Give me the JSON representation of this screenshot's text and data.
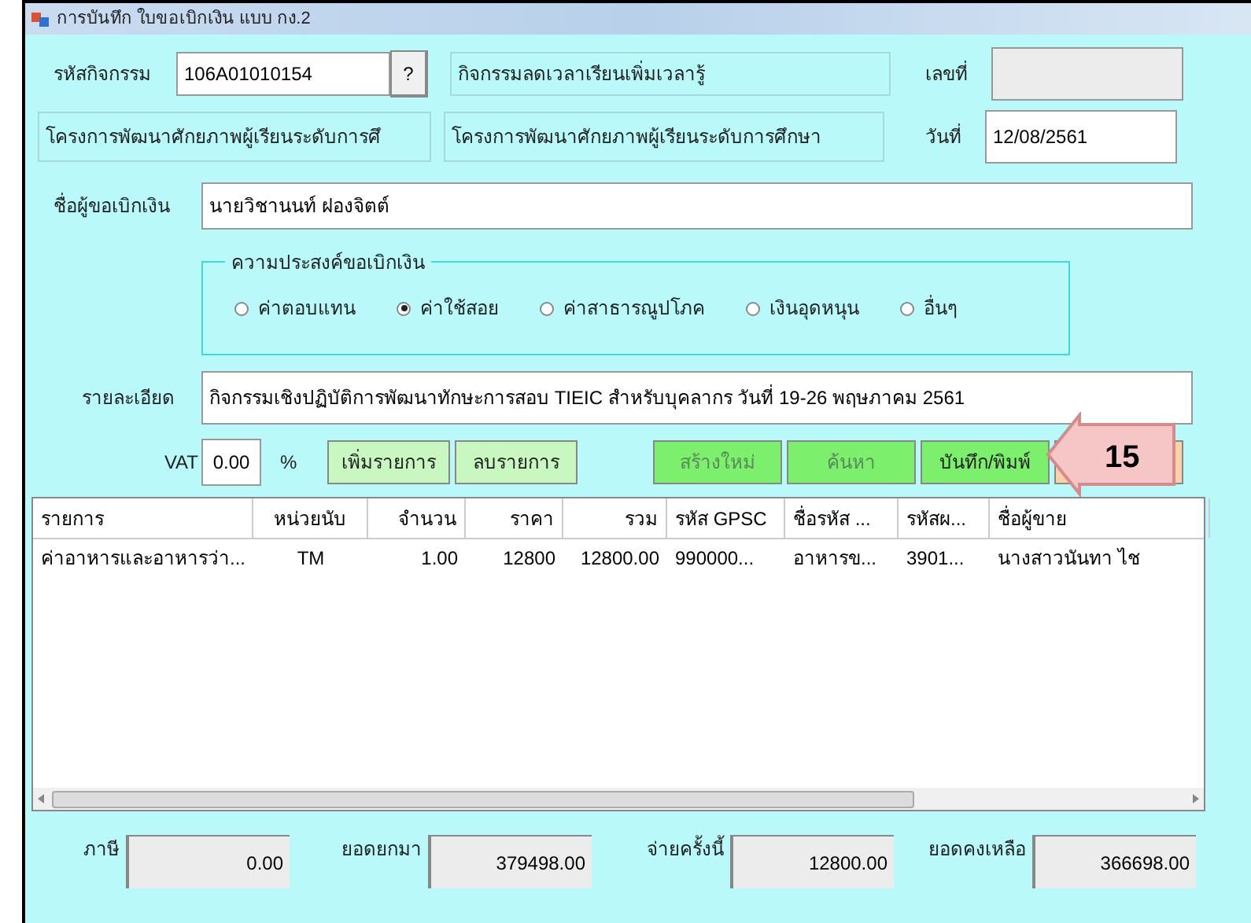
{
  "window": {
    "title": "การบันทึก ใบขอเบิกเงิน แบบ กง.2"
  },
  "activity": {
    "label": "รหัสกิจกรรม",
    "value": "106A01010154",
    "lookup": "?",
    "name": "กิจกรรมลดเวลาเรียนเพิ่มเวลารู้"
  },
  "number": {
    "label": "เลขที่"
  },
  "project": {
    "code_text": "โครงการพัฒนาศักยภาพผู้เรียนระดับการศึ",
    "name": "โครงการพัฒนาศักยภาพผู้เรียนระดับการศึกษา"
  },
  "date": {
    "label": "วันที่",
    "value": "12/08/2561"
  },
  "requester": {
    "label": "ชื่อผู้ขอเบิกเงิน",
    "value": "นายวิชานนท์ ฝองจิตต์"
  },
  "purpose": {
    "legend": "ความประสงค์ขอเบิกเงิน",
    "options": [
      {
        "label": "ค่าตอบแทน",
        "selected": false
      },
      {
        "label": "ค่าใช้สอย",
        "selected": true
      },
      {
        "label": "ค่าสาธารณูปโภค",
        "selected": false
      },
      {
        "label": "เงินอุดหนุน",
        "selected": false
      },
      {
        "label": "อื่นๆ",
        "selected": false
      }
    ]
  },
  "detail": {
    "label": "รายละเอียด",
    "value": "กิจกรรมเชิงปฏิบัติการพัฒนาทักษะการสอบ TIEIC สำหรับบุคลากร วันที่ 19-26 พฤษภาคม 2561"
  },
  "vat": {
    "label": "VAT",
    "value": "0.00",
    "unit": "%"
  },
  "buttons": [
    {
      "label": "เพิ่มรายการ",
      "kind": "light",
      "disabled": false
    },
    {
      "label": "ลบรายการ",
      "kind": "light",
      "disabled": false
    },
    {
      "label": "สร้างใหม่",
      "kind": "green",
      "disabled": true
    },
    {
      "label": "ค้นหา",
      "kind": "green",
      "disabled": true
    },
    {
      "label": "บันทึก/พิมพ์",
      "kind": "green",
      "disabled": false
    },
    {
      "kind": "orange"
    }
  ],
  "callout": {
    "label": "15"
  },
  "table": {
    "columns": [
      "รายการ",
      "หน่วยนับ",
      "จำนวน",
      "ราคา",
      "รวม",
      "รหัส GPSC",
      "ชื่อรหัส ...",
      "รหัสผ...",
      "ชื่อผู้ขาย"
    ],
    "rows": [
      [
        "ค่าอาหารและอาหารว่า...",
        "TM",
        "1.00",
        "12800",
        "12800.00",
        "990000...",
        "อาหารข...",
        "3901...",
        "นางสาวนันทา ไช"
      ]
    ]
  },
  "totals": [
    {
      "label": "ภาษี",
      "value": "0.00"
    },
    {
      "label": "ยอดยกมา",
      "value": "379498.00"
    },
    {
      "label": "จ่ายครั้งนี้",
      "value": "12800.00"
    },
    {
      "label": "ยอดคงเหลือ",
      "value": "366698.00"
    }
  ]
}
